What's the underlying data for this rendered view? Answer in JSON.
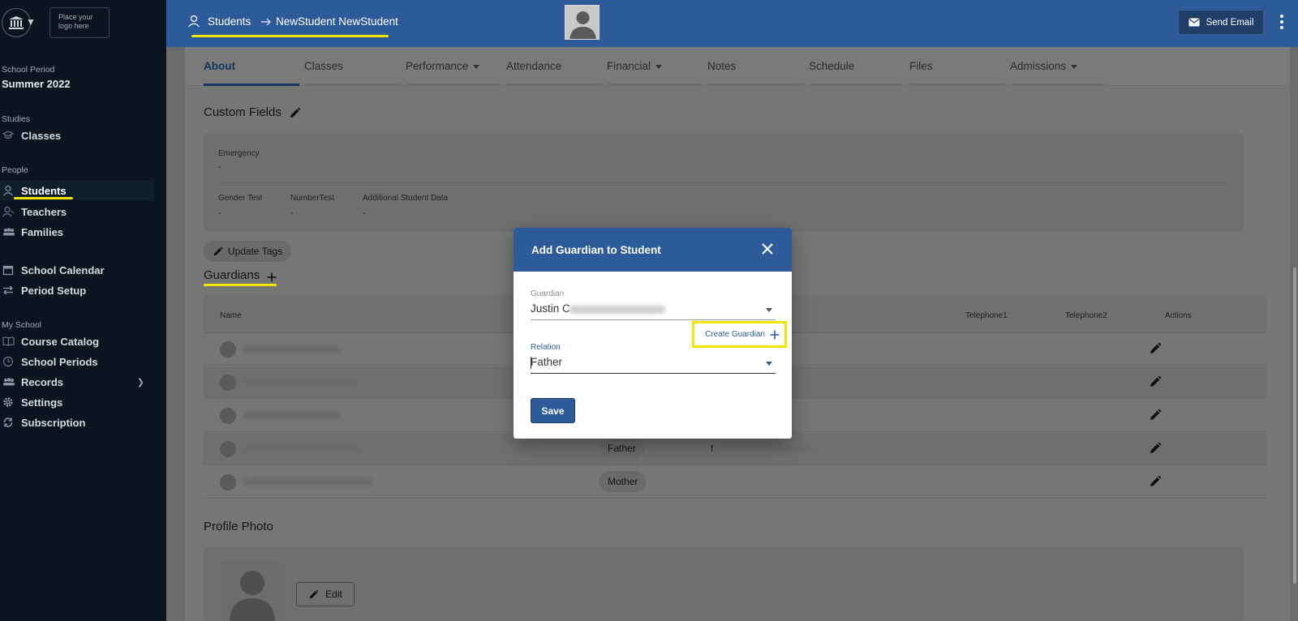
{
  "sidebar": {
    "logo_placeholder": "Place your logo here",
    "period_label": "School Period",
    "period_value": "Summer 2022",
    "studies_label": "Studies",
    "classes": "Classes",
    "people_label": "People",
    "students": "Students",
    "teachers": "Teachers",
    "families": "Families",
    "school_calendar": "School Calendar",
    "period_setup": "Period Setup",
    "myschool_label": "My School",
    "course_catalog": "Course Catalog",
    "school_periods": "School Periods",
    "records": "Records",
    "settings": "Settings",
    "subscription": "Subscription"
  },
  "header": {
    "crumb_students": "Students",
    "crumb_student": "NewStudent NewStudent",
    "send_email": "Send Email"
  },
  "tabs": [
    {
      "label": "About"
    },
    {
      "label": "Classes"
    },
    {
      "label": "Performance"
    },
    {
      "label": "Attendance"
    },
    {
      "label": "Financial"
    },
    {
      "label": "Notes"
    },
    {
      "label": "Schedule"
    },
    {
      "label": "Files"
    },
    {
      "label": "Admissions"
    }
  ],
  "custom_fields": {
    "title": "Custom Fields",
    "emergency_label": "Emergency",
    "emergency_value": "-",
    "gender_label": "Gender Test",
    "gender_value": "-",
    "number_label": "NumberTest",
    "number_value": "-",
    "additional_label": "Additional Student Data",
    "additional_value": "-"
  },
  "update_tags": "Update Tags",
  "guardians": {
    "title": "Guardians",
    "columns": {
      "name": "Name",
      "tel1": "Telephone1",
      "tel2": "Telephone2",
      "actions": "Actions"
    },
    "rows": [
      {
        "relation": "",
        "email": ""
      },
      {
        "relation": "",
        "email": ""
      },
      {
        "relation": "",
        "email": ""
      },
      {
        "relation": "Father",
        "email": "f"
      },
      {
        "relation": "Mother",
        "email": ""
      }
    ]
  },
  "profile_photo": {
    "title": "Profile Photo",
    "edit": "Edit"
  },
  "modal": {
    "title": "Add Guardian to Student",
    "guardian_label": "Guardian",
    "guardian_value": "Justin C",
    "create_guardian": "Create Guardian",
    "relation_label": "Relation",
    "relation_value": "Father",
    "save": "Save"
  },
  "colors": {
    "primary": "#2d5a98",
    "highlight": "#f2e600",
    "sidebar": "#0b1520"
  }
}
